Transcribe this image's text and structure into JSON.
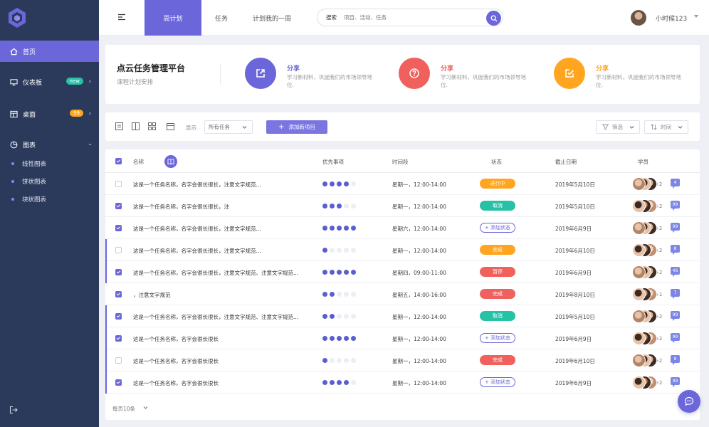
{
  "sidebar": {
    "items": [
      {
        "label": "首页",
        "icon": "home-icon",
        "active": true
      },
      {
        "label": "仪表板",
        "icon": "monitor-icon",
        "badge": "new",
        "badge_color": "#27c2a6"
      },
      {
        "label": "桌面",
        "icon": "desktop-icon",
        "badge": "99",
        "badge_color": "#ffa51f"
      },
      {
        "label": "图表",
        "icon": "pie-chart-icon"
      }
    ],
    "subitems": [
      "线性图表",
      "饼状图表",
      "块状图表"
    ]
  },
  "topbar": {
    "tabs": [
      "周计划",
      "任务",
      "计划我的一周"
    ],
    "search_label": "搜索",
    "search_placeholder": "项目、活动、任务",
    "user_name": "小时候123"
  },
  "hero": {
    "title": "点云任务管理平台",
    "subtitle": "课程计划安排",
    "shares": [
      {
        "title": "分享",
        "desc": "学习新材料，巩固我们的市场领导地位.",
        "color": "#6b66d9",
        "icon": "share-external-icon"
      },
      {
        "title": "分享",
        "desc": "学习新材料，巩固我们的市场领导地位.",
        "color": "#f0605c",
        "icon": "question-icon"
      },
      {
        "title": "分享",
        "desc": "学习新材料，巩固我们的市场领导地位.",
        "color": "#ffa51f",
        "icon": "edit-check-icon"
      }
    ]
  },
  "toolbar": {
    "show_label": "显示",
    "select_value": "所有任务",
    "add_label": "添加新项目",
    "filter_label": "筛选",
    "time_label": "时间"
  },
  "table": {
    "headers": {
      "name": "名称",
      "priority": "优先事项",
      "time": "时间段",
      "status": "状态",
      "deadline": "截止日期",
      "members": "学员"
    },
    "rows": [
      {
        "checked": false,
        "marked": false,
        "name": "这是一个任务名称，名字会很长很长，注意文字规范...",
        "priority": 4,
        "time": "星期一，12:00-14:00",
        "status": "进行中",
        "status_color": "#ffa51f",
        "deadline": "2019年5月10日",
        "more": "+2",
        "msgs": "4"
      },
      {
        "checked": true,
        "marked": false,
        "name": "这是一个任务名称，名字会很长很长，注",
        "priority": 3,
        "time": "星期一，12:00-14:00",
        "status": "取消",
        "status_color": "#27c2a6",
        "deadline": "2019年5月10日",
        "more": "+2",
        "msgs": "99"
      },
      {
        "checked": true,
        "marked": false,
        "name": "这是一个任务名称，名字会很长很长，注意文字规范...",
        "priority": 5,
        "time": "星期六，12:00-14:00",
        "status": "+ 添加状态",
        "status_color": "outline",
        "deadline": "2019年6月9日",
        "more": "+2",
        "msgs": "99"
      },
      {
        "checked": false,
        "marked": true,
        "name": "这是一个任务名称，名字会很长很长，注意文字规范...",
        "priority": 1,
        "time": "星期一，12:00-14:00",
        "status": "完成",
        "status_color": "#ffa51f",
        "deadline": "2019年6月10日",
        "more": "+2",
        "msgs": "8"
      },
      {
        "checked": true,
        "marked": true,
        "name": "这是一个任务名称，名字会很长很长，注意文字规范、注意文字规范...",
        "priority": 5,
        "time": "星期四，09:00-11:00",
        "status": "暂停",
        "status_color": "#f0605c",
        "deadline": "2019年6月9日",
        "more": "+2",
        "msgs": "46"
      },
      {
        "checked": true,
        "marked": false,
        "name": "，注意文字规范",
        "priority": 2,
        "time": "星期五，14:00-16:00",
        "status": "完成",
        "status_color": "#f0605c",
        "deadline": "2019年8月10日",
        "more": "+1",
        "msgs": "7"
      },
      {
        "checked": true,
        "marked": true,
        "name": "这是一个任务名称，名字会很长很长，注意文字规范、注意文字规范...",
        "priority": 2,
        "time": "星期一，12:00-14:00",
        "status": "取消",
        "status_color": "#27c2a6",
        "deadline": "2019年5月10日",
        "more": "+2",
        "msgs": "99"
      },
      {
        "checked": true,
        "marked": true,
        "name": "这是一个任务名称，名字会很长很长",
        "priority": 5,
        "time": "星期一，12:00-14:00",
        "status": "+ 添加状态",
        "status_color": "outline",
        "deadline": "2019年6月9日",
        "more": "+2",
        "msgs": "99"
      },
      {
        "checked": false,
        "marked": true,
        "name": "这是一个任务名称，名字会很长很长",
        "priority": 1,
        "time": "星期一，12:00-14:00",
        "status": "完成",
        "status_color": "#f0605c",
        "deadline": "2019年6月10日",
        "more": "+2",
        "msgs": "8"
      },
      {
        "checked": true,
        "marked": true,
        "name": "这是一个任务名称，名字会很长很长",
        "priority": 4,
        "time": "星期一，12:00-14:00",
        "status": "+ 添加状态",
        "status_color": "outline",
        "deadline": "2019年6月9日",
        "more": "+2",
        "msgs": "99"
      }
    ],
    "footer_label": "每页10条"
  },
  "colors": {
    "accent": "#6b66d9",
    "sidebar": "#2b3a5b",
    "green": "#27c2a6",
    "orange": "#ffa51f",
    "red": "#f0605c"
  }
}
